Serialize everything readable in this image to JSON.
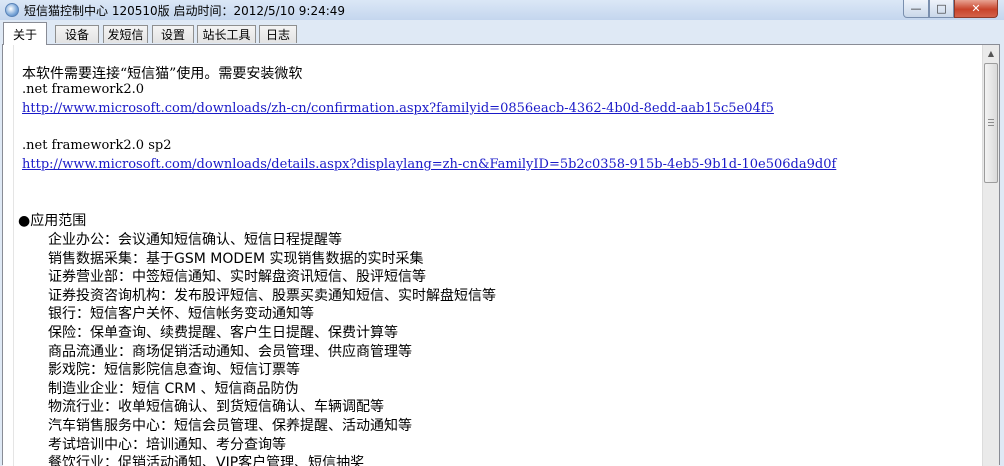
{
  "window": {
    "title": "短信猫控制中心 120510版 启动时间：2012/5/10 9:24:49",
    "min": "—",
    "max": "□",
    "close": "✕"
  },
  "tabs": [
    {
      "label": "关于",
      "active": true
    },
    {
      "label": "设备"
    },
    {
      "label": "发短信"
    },
    {
      "label": "设置"
    },
    {
      "label": "站长工具"
    },
    {
      "label": "日志"
    }
  ],
  "about": {
    "intro": "本软件需要连接“短信猫”使用。需要安装微软",
    "framework1": ".net framework2.0",
    "link1": "http://www.microsoft.com/downloads/zh-cn/confirmation.aspx?familyid=0856eacb-4362-4b0d-8edd-aab15c5e04f5",
    "framework2": ".net framework2.0 sp2",
    "link2": "http://www.microsoft.com/downloads/details.aspx?displaylang=zh-cn&FamilyID=5b2c0358-915b-4eb5-9b1d-10e506da9d0f",
    "section_title": "●应用范围",
    "applications": [
      "企业办公：会议通知短信确认、短信日程提醒等",
      "销售数据采集：基于GSM MODEM 实现销售数据的实时采集",
      "证券营业部：中签短信通知、实时解盘资讯短信、股评短信等",
      "证券投资咨询机构：发布股评短信、股票买卖通知短信、实时解盘短信等",
      "银行：短信客户关怀、短信帐务变动通知等",
      "保险：保单查询、续费提醒、客户生日提醒、保费计算等",
      "商品流通业：商场促销活动通知、会员管理、供应商管理等",
      "影戏院：短信影院信息查询、短信订票等",
      "制造业企业：短信 CRM 、短信商品防伪",
      "物流行业：收单短信确认、到货短信确认、车辆调配等",
      "汽车销售服务中心：短信会员管理、保养提醒、活动通知等",
      "考试培训中心：培训通知、考分查询等",
      "餐饮行业：促销活动通知、VIP客户管理、短信抽奖"
    ]
  }
}
